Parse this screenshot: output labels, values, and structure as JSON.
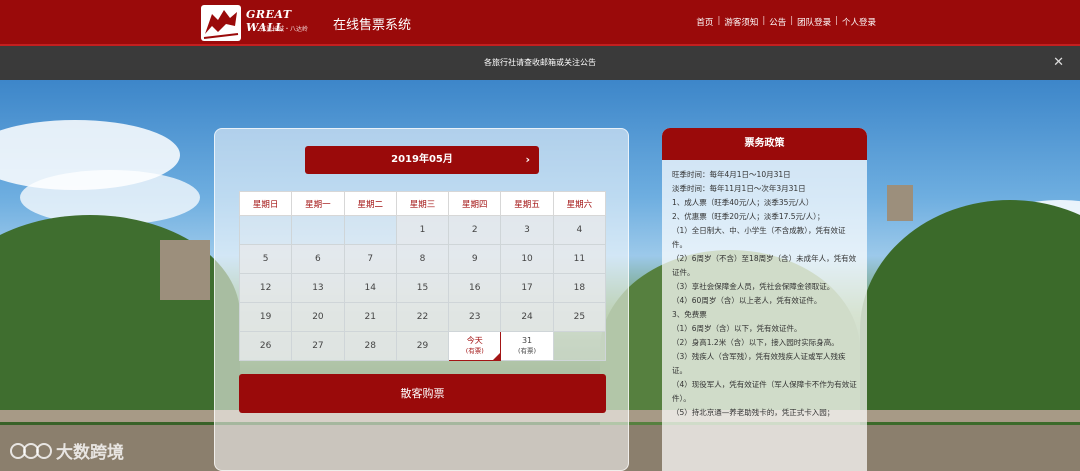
{
  "header": {
    "logo_text": "GREAT WALL",
    "logo_sub": "万里长城・八达岭",
    "site_title": "在线售票系统",
    "nav": [
      "首页",
      "游客须知",
      "公告",
      "团队登录",
      "个人登录"
    ]
  },
  "notice": {
    "text": "各旅行社请查收邮箱或关注公告",
    "close_icon": "close-icon"
  },
  "calendar": {
    "month_label": "2019年05月",
    "next_icon": "chevron-right-icon",
    "weekdays": [
      "星期日",
      "星期一",
      "星期二",
      "星期三",
      "星期四",
      "星期五",
      "星期六"
    ],
    "rows": [
      [
        "",
        "",
        "",
        "1",
        "2",
        "3",
        "4"
      ],
      [
        "5",
        "6",
        "7",
        "8",
        "9",
        "10",
        "11"
      ],
      [
        "12",
        "13",
        "14",
        "15",
        "16",
        "17",
        "18"
      ],
      [
        "19",
        "20",
        "21",
        "22",
        "23",
        "24",
        "25"
      ],
      [
        "26",
        "27",
        "28",
        "29",
        "今天",
        "31",
        ""
      ]
    ],
    "today_label": "今天",
    "today_sub": "(有票)",
    "day31_label": "31",
    "day31_sub": "(有票)",
    "buy_label": "散客购票"
  },
  "policy": {
    "title": "票务政策",
    "lines": [
      "旺季时间：每年4月1日～10月31日",
      "淡季时间：每年11月1日～次年3月31日",
      "1、成人票（旺季40元/人；淡季35元/人）",
      "2、优惠票（旺季20元/人；淡季17.5元/人）；",
      "（1）全日制大、中、小学生（不含成教），凭有效证件。",
      "（2）6周岁（不含）至18周岁（含）未成年人，凭有效证件。",
      "（3）享社会保障金人员，凭社会保障金领取证。",
      "（4）60周岁（含）以上老人，凭有效证件。",
      "3、免费票",
      "（1）6周岁（含）以下，凭有效证件。",
      "（2）身高1.2米（含）以下，接入园时实际身高。",
      "（3）残疾人（含军残），凭有效残疾人证或军人残疾证。",
      "（4）现役军人，凭有效证件（军人保障卡不作为有效证件）。",
      "（5）持北京通—养老助残卡的，凭正式卡入园；"
    ]
  },
  "watermark": {
    "text": "大数跨境",
    "icon": "watermark-logo-icon"
  },
  "colors": {
    "brand": "#9a0a0a",
    "notice_bg": "#3a3a3a"
  }
}
